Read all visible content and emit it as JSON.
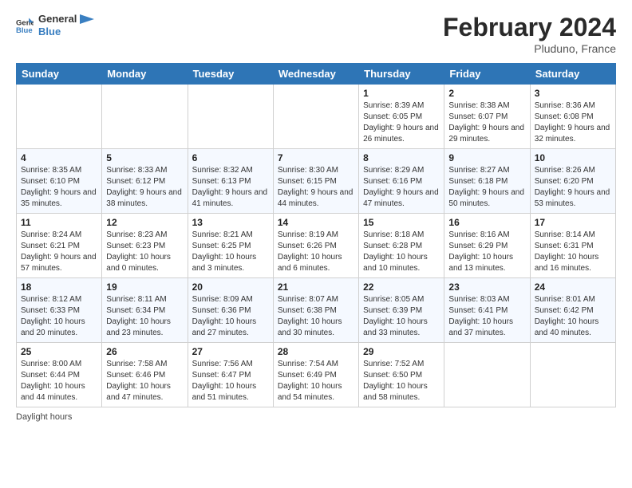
{
  "header": {
    "logo_line1": "General",
    "logo_line2": "Blue",
    "title": "February 2024",
    "subtitle": "Pluduno, France"
  },
  "footer": {
    "daylight_label": "Daylight hours"
  },
  "days_of_week": [
    "Sunday",
    "Monday",
    "Tuesday",
    "Wednesday",
    "Thursday",
    "Friday",
    "Saturday"
  ],
  "weeks": [
    [
      {
        "date": "",
        "info": ""
      },
      {
        "date": "",
        "info": ""
      },
      {
        "date": "",
        "info": ""
      },
      {
        "date": "",
        "info": ""
      },
      {
        "date": "1",
        "info": "Sunrise: 8:39 AM\nSunset: 6:05 PM\nDaylight: 9 hours and 26 minutes."
      },
      {
        "date": "2",
        "info": "Sunrise: 8:38 AM\nSunset: 6:07 PM\nDaylight: 9 hours and 29 minutes."
      },
      {
        "date": "3",
        "info": "Sunrise: 8:36 AM\nSunset: 6:08 PM\nDaylight: 9 hours and 32 minutes."
      }
    ],
    [
      {
        "date": "4",
        "info": "Sunrise: 8:35 AM\nSunset: 6:10 PM\nDaylight: 9 hours and 35 minutes."
      },
      {
        "date": "5",
        "info": "Sunrise: 8:33 AM\nSunset: 6:12 PM\nDaylight: 9 hours and 38 minutes."
      },
      {
        "date": "6",
        "info": "Sunrise: 8:32 AM\nSunset: 6:13 PM\nDaylight: 9 hours and 41 minutes."
      },
      {
        "date": "7",
        "info": "Sunrise: 8:30 AM\nSunset: 6:15 PM\nDaylight: 9 hours and 44 minutes."
      },
      {
        "date": "8",
        "info": "Sunrise: 8:29 AM\nSunset: 6:16 PM\nDaylight: 9 hours and 47 minutes."
      },
      {
        "date": "9",
        "info": "Sunrise: 8:27 AM\nSunset: 6:18 PM\nDaylight: 9 hours and 50 minutes."
      },
      {
        "date": "10",
        "info": "Sunrise: 8:26 AM\nSunset: 6:20 PM\nDaylight: 9 hours and 53 minutes."
      }
    ],
    [
      {
        "date": "11",
        "info": "Sunrise: 8:24 AM\nSunset: 6:21 PM\nDaylight: 9 hours and 57 minutes."
      },
      {
        "date": "12",
        "info": "Sunrise: 8:23 AM\nSunset: 6:23 PM\nDaylight: 10 hours and 0 minutes."
      },
      {
        "date": "13",
        "info": "Sunrise: 8:21 AM\nSunset: 6:25 PM\nDaylight: 10 hours and 3 minutes."
      },
      {
        "date": "14",
        "info": "Sunrise: 8:19 AM\nSunset: 6:26 PM\nDaylight: 10 hours and 6 minutes."
      },
      {
        "date": "15",
        "info": "Sunrise: 8:18 AM\nSunset: 6:28 PM\nDaylight: 10 hours and 10 minutes."
      },
      {
        "date": "16",
        "info": "Sunrise: 8:16 AM\nSunset: 6:29 PM\nDaylight: 10 hours and 13 minutes."
      },
      {
        "date": "17",
        "info": "Sunrise: 8:14 AM\nSunset: 6:31 PM\nDaylight: 10 hours and 16 minutes."
      }
    ],
    [
      {
        "date": "18",
        "info": "Sunrise: 8:12 AM\nSunset: 6:33 PM\nDaylight: 10 hours and 20 minutes."
      },
      {
        "date": "19",
        "info": "Sunrise: 8:11 AM\nSunset: 6:34 PM\nDaylight: 10 hours and 23 minutes."
      },
      {
        "date": "20",
        "info": "Sunrise: 8:09 AM\nSunset: 6:36 PM\nDaylight: 10 hours and 27 minutes."
      },
      {
        "date": "21",
        "info": "Sunrise: 8:07 AM\nSunset: 6:38 PM\nDaylight: 10 hours and 30 minutes."
      },
      {
        "date": "22",
        "info": "Sunrise: 8:05 AM\nSunset: 6:39 PM\nDaylight: 10 hours and 33 minutes."
      },
      {
        "date": "23",
        "info": "Sunrise: 8:03 AM\nSunset: 6:41 PM\nDaylight: 10 hours and 37 minutes."
      },
      {
        "date": "24",
        "info": "Sunrise: 8:01 AM\nSunset: 6:42 PM\nDaylight: 10 hours and 40 minutes."
      }
    ],
    [
      {
        "date": "25",
        "info": "Sunrise: 8:00 AM\nSunset: 6:44 PM\nDaylight: 10 hours and 44 minutes."
      },
      {
        "date": "26",
        "info": "Sunrise: 7:58 AM\nSunset: 6:46 PM\nDaylight: 10 hours and 47 minutes."
      },
      {
        "date": "27",
        "info": "Sunrise: 7:56 AM\nSunset: 6:47 PM\nDaylight: 10 hours and 51 minutes."
      },
      {
        "date": "28",
        "info": "Sunrise: 7:54 AM\nSunset: 6:49 PM\nDaylight: 10 hours and 54 minutes."
      },
      {
        "date": "29",
        "info": "Sunrise: 7:52 AM\nSunset: 6:50 PM\nDaylight: 10 hours and 58 minutes."
      },
      {
        "date": "",
        "info": ""
      },
      {
        "date": "",
        "info": ""
      }
    ]
  ]
}
